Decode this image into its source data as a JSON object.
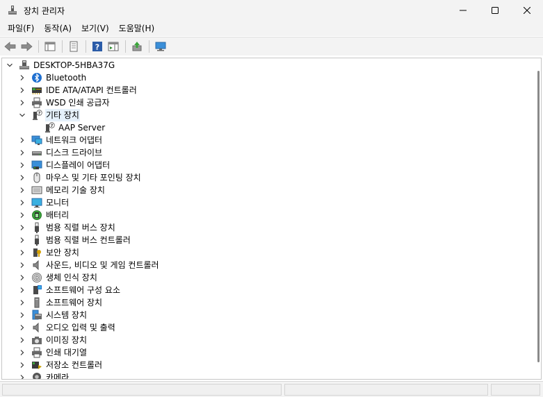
{
  "window": {
    "title": "장치 관리자"
  },
  "menu": {
    "items": [
      "파일(F)",
      "동작(A)",
      "보기(V)",
      "도움말(H)"
    ]
  },
  "tree": {
    "root": "DESKTOP-5HBA37G",
    "items": [
      {
        "label": "Bluetooth",
        "icon": "bluetooth-icon",
        "expanded": false
      },
      {
        "label": "IDE ATA/ATAPI 컨트롤러",
        "icon": "ide-controller-icon",
        "expanded": false
      },
      {
        "label": "WSD 인쇄 공급자",
        "icon": "printer-icon",
        "expanded": false
      },
      {
        "label": "기타 장치",
        "icon": "unknown-device-icon",
        "expanded": true,
        "selected": true,
        "children": [
          {
            "label": "AAP Server",
            "icon": "unknown-device-icon"
          }
        ]
      },
      {
        "label": "네트워크 어댑터",
        "icon": "network-adapter-icon",
        "expanded": false
      },
      {
        "label": "디스크 드라이브",
        "icon": "disk-drive-icon",
        "expanded": false
      },
      {
        "label": "디스플레이 어댑터",
        "icon": "display-adapter-icon",
        "expanded": false
      },
      {
        "label": "마우스 및 기타 포인팅 장치",
        "icon": "mouse-icon",
        "expanded": false
      },
      {
        "label": "메모리 기술 장치",
        "icon": "memory-icon",
        "expanded": false
      },
      {
        "label": "모니터",
        "icon": "monitor-icon",
        "expanded": false
      },
      {
        "label": "배터리",
        "icon": "battery-icon",
        "expanded": false
      },
      {
        "label": "범용 직렬 버스 장치",
        "icon": "usb-icon",
        "expanded": false
      },
      {
        "label": "범용 직렬 버스 컨트롤러",
        "icon": "usb-icon",
        "expanded": false
      },
      {
        "label": "보안 장치",
        "icon": "security-key-icon",
        "expanded": false
      },
      {
        "label": "사운드, 비디오 및 게임 컨트롤러",
        "icon": "speaker-icon",
        "expanded": false
      },
      {
        "label": "생체 인식 장치",
        "icon": "fingerprint-icon",
        "expanded": false
      },
      {
        "label": "소프트웨어 구성 요소",
        "icon": "software-component-icon",
        "expanded": false
      },
      {
        "label": "소프트웨어 장치",
        "icon": "software-device-icon",
        "expanded": false
      },
      {
        "label": "시스템 장치",
        "icon": "system-device-icon",
        "expanded": false
      },
      {
        "label": "오디오 입력 및 출력",
        "icon": "speaker-icon",
        "expanded": false
      },
      {
        "label": "이미징 장치",
        "icon": "camera-icon",
        "expanded": false
      },
      {
        "label": "인쇄 대기열",
        "icon": "printer-icon",
        "expanded": false
      },
      {
        "label": "저장소 컨트롤러",
        "icon": "storage-controller-icon",
        "expanded": false
      },
      {
        "label": "카메라",
        "icon": "webcam-icon",
        "expanded": false
      }
    ]
  },
  "colors": {
    "chrome_bg": "#f3f3f3",
    "selection": "#e5f1fb",
    "border": "#c6c6c6"
  }
}
